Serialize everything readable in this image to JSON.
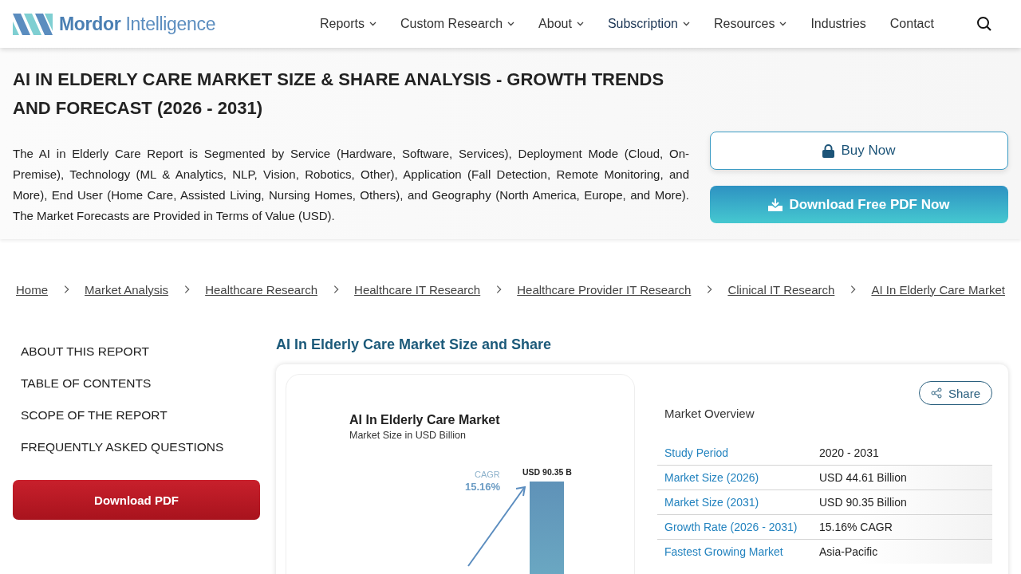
{
  "header": {
    "logo": "**Mordor** Intelligence",
    "nav": [
      {
        "label": "Reports",
        "dropdown": true,
        "selected": false
      },
      {
        "label": "Custom Research",
        "dropdown": true,
        "selected": false
      },
      {
        "label": "About",
        "dropdown": true,
        "selected": false
      },
      {
        "label": "Subscription",
        "dropdown": true,
        "selected": true
      },
      {
        "label": "Resources",
        "dropdown": true,
        "selected": false
      },
      {
        "label": "Industries",
        "dropdown": false,
        "selected": false
      },
      {
        "label": "Contact",
        "dropdown": false,
        "selected": false
      }
    ]
  },
  "hero": {
    "title": "AI IN ELDERLY CARE MARKET SIZE & SHARE ANALYSIS - GROWTH TRENDS AND FORECAST (2026 - 2031)",
    "description": "The AI in Elderly Care Report is Segmented by Service (Hardware, Software, Services), Deployment Mode (Cloud, On-Premise), Technology (ML & Analytics, NLP, Vision, Robotics, Other), Application (Fall Detection, Remote Monitoring, and More), End User (Home Care, Assisted Living, Nursing Homes, Others), and Geography (North America, Europe, and More). The Market Forecasts are Provided in Terms of Value (USD).",
    "buy_button": "Buy Now",
    "download_button": "Download Free PDF Now"
  },
  "breadcrumb": [
    "Home",
    "Market Analysis",
    "Healthcare Research",
    "Healthcare IT Research",
    "Healthcare Provider IT Research",
    "Clinical IT Research",
    "AI In Elderly Care Market"
  ],
  "sidebar": {
    "items": [
      "ABOUT THIS REPORT",
      "TABLE OF CONTENTS",
      "SCOPE OF THE REPORT",
      "FREQUENTLY ASKED QUESTIONS"
    ],
    "download_button": "Download PDF"
  },
  "main": {
    "heading": "AI In Elderly Care Market Size and Share",
    "infographic": {
      "title": "AI In Elderly Care Market",
      "subtitle": "Market Size in USD Billion",
      "cagr_label": "CAGR",
      "cagr_value": "15.16%",
      "bar_label": "USD 90.35 B"
    },
    "share_button": "Share",
    "overview_title": "Market Overview",
    "overview": [
      {
        "label": "Study Period",
        "value": "2020 - 2031"
      },
      {
        "label": "Market Size (2026)",
        "value": "USD 44.61 Billion"
      },
      {
        "label": "Market Size (2031)",
        "value": "USD 90.35 Billion"
      },
      {
        "label": "Growth Rate (2026 - 2031)",
        "value": "15.16% CAGR"
      },
      {
        "label": "Fastest Growing Market",
        "value": "Asia-Pacific"
      }
    ]
  }
}
